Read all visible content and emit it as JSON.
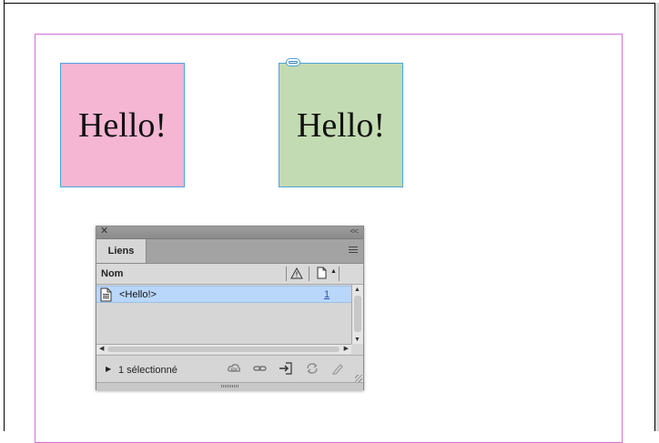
{
  "document": {
    "frames": [
      {
        "text": "Hello!",
        "fill": "#f4b6d3"
      },
      {
        "text": "Hello!",
        "fill": "#c3dbb2"
      }
    ],
    "margin_guide_color": "#d26fd6",
    "frame_edge_color": "#4fa3d9"
  },
  "panel": {
    "close_glyph": "✕",
    "collapse_glyph": "<<",
    "tab_label": "Liens",
    "column_name": "Nom",
    "rows": [
      {
        "name": "<Hello!>",
        "page": "1",
        "icon": "document-icon",
        "selected": true
      }
    ],
    "status": "1 sélectionné",
    "footer_icons": [
      "cloud-link-icon",
      "relink-icon",
      "go-to-link-icon",
      "update-link-icon",
      "edit-original-icon"
    ],
    "selection_color": "#b9d7fb"
  }
}
